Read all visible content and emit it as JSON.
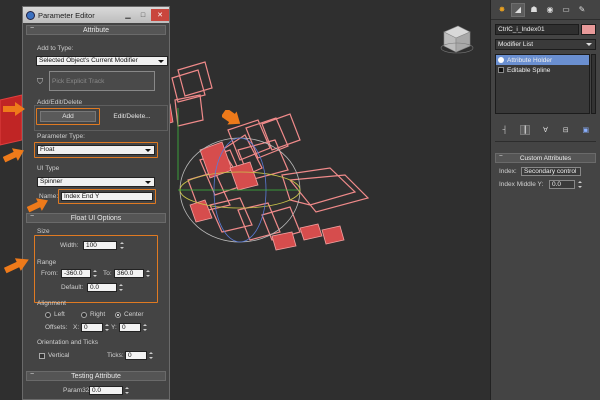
{
  "viewport": {
    "viewcube_label": "FRONT"
  },
  "param_editor": {
    "title": "Parameter Editor",
    "attribute_rollout": "Attribute",
    "add_to_type_label": "Add to Type:",
    "add_to_type_value": "Selected Object's Current Modifier",
    "pick_explicit_track": "Pick Explicit Track",
    "add_edit_delete_label": "Add/Edit/Delete",
    "add_button": "Add",
    "edit_delete_button": "Edit/Delete...",
    "parameter_type_label": "Parameter Type:",
    "parameter_type_value": "Float",
    "ui_type_label": "UI Type",
    "ui_type_value": "Spinner",
    "name_label": "Name:",
    "name_value": "Index End Y",
    "float_ui_rollout": "Float UI Options",
    "size_label": "Size",
    "width_label": "Width:",
    "width_value": "100",
    "range_label": "Range",
    "from_label": "From:",
    "from_value": "-360.0",
    "to_label": "To:",
    "to_value": "360.0",
    "default_label": "Default:",
    "default_value": "0.0",
    "alignment_label": "Alignment",
    "align_left": "Left",
    "align_right": "Right",
    "align_center": "Center",
    "offsets_label": "Offsets:",
    "offset_x_label": "X:",
    "offset_x_value": "0",
    "offset_y_label": "Y:",
    "offset_y_value": "0",
    "orientation_label": "Orientation and Ticks",
    "vertical_label": "Vertical",
    "ticks_label": "Ticks:",
    "ticks_value": "0",
    "testing_rollout": "Testing Attribute",
    "param_label": "Param32:",
    "param_value": "0.0"
  },
  "command_panel": {
    "object_name": "CtrlC_i_Index01",
    "object_color": "#e89a9a",
    "modifier_list": "Modifier List",
    "stack": [
      {
        "label": "Attribute Holder",
        "selected": true
      },
      {
        "label": "Editable Spline",
        "selected": false
      }
    ],
    "custom_attributes_rollout": "Custom Attributes",
    "index_label": "Index:",
    "index_value": "Secondary control",
    "index_middle_label": "Index Middle Y:",
    "index_middle_value": "0.0"
  },
  "colors": {
    "highlight": "#e07a22",
    "selection": "#6a8fd0",
    "rig": "#f08a8a"
  }
}
